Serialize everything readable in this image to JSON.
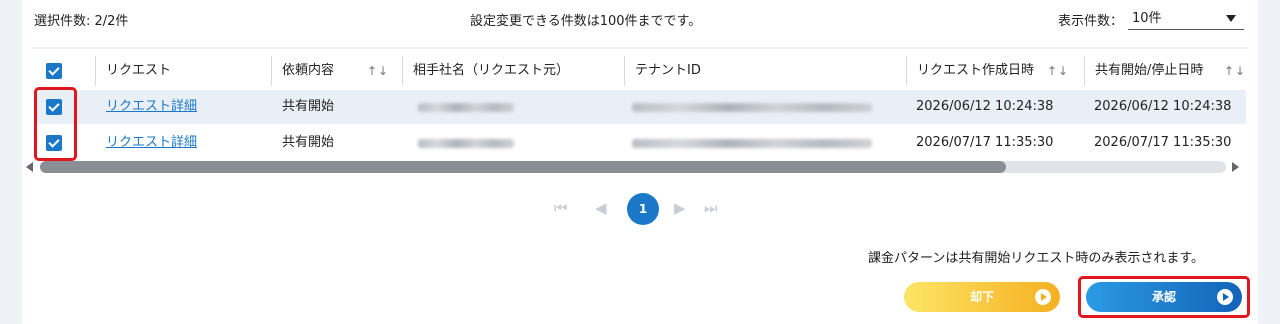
{
  "toolbar": {
    "selected_count": "選択件数: 2/2件",
    "notice": "設定変更できる件数は100件までです。",
    "display_count_label": "表示件数：",
    "display_count_value": "10件"
  },
  "table": {
    "headers": {
      "request": "リクエスト",
      "content": "依頼内容",
      "partner": "相手社名（リクエスト元）",
      "tenant": "テナントID",
      "created": "リクエスト作成日時",
      "share": "共有開始/停止日時"
    },
    "sort_glyph": "↑↓",
    "rows": [
      {
        "link": "リクエスト詳細",
        "content": "共有開始",
        "created": "2026/06/12 10:24:38",
        "share": "2026/06/12 10:24:38"
      },
      {
        "link": "リクエスト詳細",
        "content": "共有開始",
        "created": "2026/07/17 11:35:30",
        "share": "2026/07/17 11:35:30"
      }
    ]
  },
  "pagination": {
    "current": "1"
  },
  "billing_note": "課金パターンは共有開始リクエスト時のみ表示されます。",
  "buttons": {
    "reject": "却下",
    "approve": "承認"
  },
  "colors": {
    "accent": "#1b78c8",
    "highlight": "#e0161e",
    "reject": "#f5b021",
    "approve": "#1463b8"
  }
}
